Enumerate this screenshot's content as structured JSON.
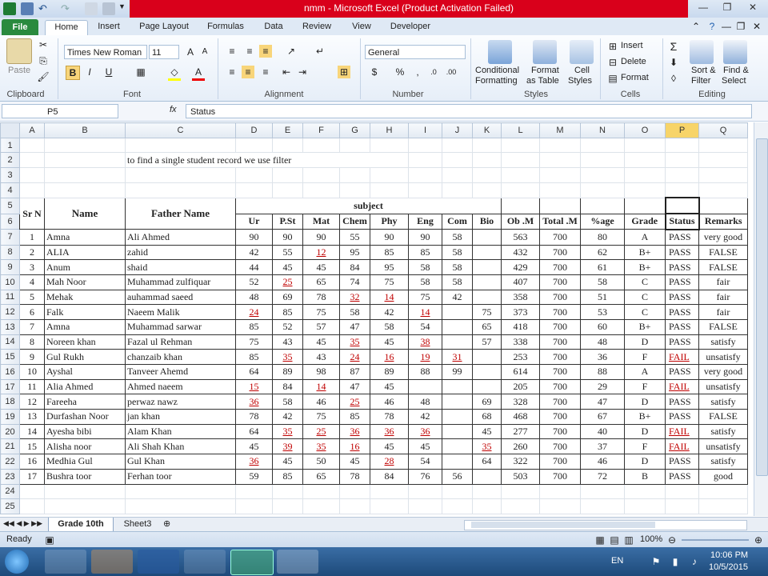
{
  "window": {
    "title": "nmm  -  Microsoft Excel (Product Activation Failed)"
  },
  "tabs": [
    "File",
    "Home",
    "Insert",
    "Page Layout",
    "Formulas",
    "Data",
    "Review",
    "View",
    "Developer"
  ],
  "ribbon": {
    "paste": "Paste",
    "font_name": "Times New Roman",
    "font_size": "11",
    "number_format": "General",
    "cond_format": "Conditional",
    "cond_format2": "Formatting",
    "format_table": "Format",
    "format_table2": "as Table",
    "cell_styles": "Cell",
    "cell_styles2": "Styles",
    "insert": "Insert",
    "delete": "Delete",
    "format": "Format",
    "sort_filter": "Sort &",
    "sort_filter2": "Filter",
    "find_select": "Find &",
    "find_select2": "Select",
    "groups": [
      "Clipboard",
      "Font",
      "Alignment",
      "Number",
      "Styles",
      "Cells",
      "Editing"
    ]
  },
  "formula_bar": {
    "name_box": "P5",
    "fx": "fx",
    "content": "Status"
  },
  "columns": [
    "A",
    "B",
    "C",
    "D",
    "E",
    "F",
    "G",
    "H",
    "I",
    "J",
    "K",
    "L",
    "M",
    "N",
    "O",
    "P",
    "Q"
  ],
  "sheet": {
    "note": "to find a single student record we use filter",
    "header": {
      "sr": "Sr N",
      "name": "Name",
      "father": "Father Name",
      "subject": "subject",
      "subjects": [
        "Ur",
        "P.St",
        "Mat",
        "Chem",
        "Phy",
        "Eng",
        "Com",
        "Bio"
      ],
      "obm": "Ob .M",
      "total": "Total .M",
      "pct": "%age",
      "grade": "Grade",
      "status": "Status",
      "remarks": "Remarks"
    },
    "rows": [
      {
        "r": "7",
        "sr": "1",
        "name": "Amna",
        "father": "Ali Ahmed",
        "s": [
          "90",
          "90",
          "90",
          "55",
          "90",
          "90",
          "58",
          ""
        ],
        "obm": "563",
        "total": "700",
        "pct": "80",
        "grade": "A",
        "status": "PASS",
        "remarks": "very good"
      },
      {
        "r": "8",
        "sr": "2",
        "name": "ALIA",
        "father": "zahid",
        "s": [
          "42",
          "55",
          "12",
          "95",
          "85",
          "85",
          "58",
          ""
        ],
        "obm": "432",
        "total": "700",
        "pct": "62",
        "grade": "B+",
        "status": "PASS",
        "remarks": "FALSE"
      },
      {
        "r": "9",
        "sr": "3",
        "name": "Anum",
        "father": "shaid",
        "s": [
          "44",
          "45",
          "45",
          "84",
          "95",
          "58",
          "58",
          ""
        ],
        "obm": "429",
        "total": "700",
        "pct": "61",
        "grade": "B+",
        "status": "PASS",
        "remarks": "FALSE"
      },
      {
        "r": "10",
        "sr": "4",
        "name": "Mah Noor",
        "father": "Muhammad zulfiquar",
        "s": [
          "52",
          "25",
          "65",
          "74",
          "75",
          "58",
          "58",
          ""
        ],
        "obm": "407",
        "total": "700",
        "pct": "58",
        "grade": "C",
        "status": "PASS",
        "remarks": "fair"
      },
      {
        "r": "11",
        "sr": "5",
        "name": "Mehak",
        "father": "auhammad saeed",
        "s": [
          "48",
          "69",
          "78",
          "32",
          "14",
          "75",
          "42",
          ""
        ],
        "obm": "358",
        "total": "700",
        "pct": "51",
        "grade": "C",
        "status": "PASS",
        "remarks": "fair"
      },
      {
        "r": "12",
        "sr": "6",
        "name": "Falk",
        "father": "Naeem  Malik",
        "s": [
          "24",
          "85",
          "75",
          "58",
          "42",
          "14",
          "",
          "75"
        ],
        "obm": "373",
        "total": "700",
        "pct": "53",
        "grade": "C",
        "status": "PASS",
        "remarks": "fair"
      },
      {
        "r": "13",
        "sr": "7",
        "name": "Amna",
        "father": "Muhammad sarwar",
        "s": [
          "85",
          "52",
          "57",
          "47",
          "58",
          "54",
          "",
          "65"
        ],
        "obm": "418",
        "total": "700",
        "pct": "60",
        "grade": "B+",
        "status": "PASS",
        "remarks": "FALSE"
      },
      {
        "r": "14",
        "sr": "8",
        "name": "Noreen khan",
        "father": "Fazal ul Rehman",
        "s": [
          "75",
          "43",
          "45",
          "35",
          "45",
          "38",
          "",
          "57"
        ],
        "obm": "338",
        "total": "700",
        "pct": "48",
        "grade": "D",
        "status": "PASS",
        "remarks": "satisfy"
      },
      {
        "r": "15",
        "sr": "9",
        "name": "Gul Rukh",
        "father": "chanzaib khan",
        "s": [
          "85",
          "35",
          "43",
          "24",
          "16",
          "19",
          "31",
          ""
        ],
        "obm": "253",
        "total": "700",
        "pct": "36",
        "grade": "F",
        "status": "FAIL",
        "remarks": "unsatisfy"
      },
      {
        "r": "16",
        "sr": "10",
        "name": "Ayshal",
        "father": "Tanveer Ahemd",
        "s": [
          "64",
          "89",
          "98",
          "87",
          "89",
          "88",
          "99",
          ""
        ],
        "obm": "614",
        "total": "700",
        "pct": "88",
        "grade": "A",
        "status": "PASS",
        "remarks": "very good"
      },
      {
        "r": "17",
        "sr": "11",
        "name": "Alia Ahmed",
        "father": "Ahmed naeem",
        "s": [
          "15",
          "84",
          "14",
          "47",
          "45",
          "",
          "",
          ""
        ],
        "obm": "205",
        "total": "700",
        "pct": "29",
        "grade": "F",
        "status": "FAIL",
        "remarks": "unsatisfy"
      },
      {
        "r": "18",
        "sr": "12",
        "name": "Fareeha",
        "father": "perwaz nawz",
        "s": [
          "36",
          "58",
          "46",
          "25",
          "46",
          "48",
          "",
          "69"
        ],
        "obm": "328",
        "total": "700",
        "pct": "47",
        "grade": "D",
        "status": "PASS",
        "remarks": "satisfy"
      },
      {
        "r": "19",
        "sr": "13",
        "name": "Durfashan Noor",
        "father": "jan khan",
        "s": [
          "78",
          "42",
          "75",
          "85",
          "78",
          "42",
          "",
          "68"
        ],
        "obm": "468",
        "total": "700",
        "pct": "67",
        "grade": "B+",
        "status": "PASS",
        "remarks": "FALSE"
      },
      {
        "r": "20",
        "sr": "14",
        "name": "Ayesha bibi",
        "father": "Alam Khan",
        "s": [
          "64",
          "35",
          "25",
          "36",
          "36",
          "36",
          "",
          "45"
        ],
        "obm": "277",
        "total": "700",
        "pct": "40",
        "grade": "D",
        "status": "FAIL",
        "remarks": "satisfy"
      },
      {
        "r": "21",
        "sr": "15",
        "name": "Alisha noor",
        "father": "Ali Shah Khan",
        "s": [
          "45",
          "39",
          "35",
          "16",
          "45",
          "45",
          "",
          "35"
        ],
        "obm": "260",
        "total": "700",
        "pct": "37",
        "grade": "F",
        "status": "FAIL",
        "remarks": "unsatisfy"
      },
      {
        "r": "22",
        "sr": "16",
        "name": "Medhia Gul",
        "father": "Gul Khan",
        "s": [
          "36",
          "45",
          "50",
          "45",
          "28",
          "54",
          "",
          "64"
        ],
        "obm": "322",
        "total": "700",
        "pct": "46",
        "grade": "D",
        "status": "PASS",
        "remarks": "satisfy"
      },
      {
        "r": "23",
        "sr": "17",
        "name": "Bushra toor",
        "father": "Ferhan toor",
        "s": [
          "59",
          "85",
          "65",
          "78",
          "84",
          "76",
          "56",
          ""
        ],
        "obm": "503",
        "total": "700",
        "pct": "72",
        "grade": "B",
        "status": "PASS",
        "remarks": "good"
      }
    ],
    "extra_rows": [
      "24",
      "25"
    ]
  },
  "sheet_tabs": [
    "Grade 10th",
    "Sheet3"
  ],
  "status": {
    "ready": "Ready",
    "zoom": "100%"
  },
  "taskbar": {
    "lang": "EN",
    "time": "10:06 PM",
    "date": "10/5/2015"
  },
  "colors": {
    "fail_red": "#c00000",
    "title_red": "#d9001b",
    "selected_header": "#f7d469"
  }
}
